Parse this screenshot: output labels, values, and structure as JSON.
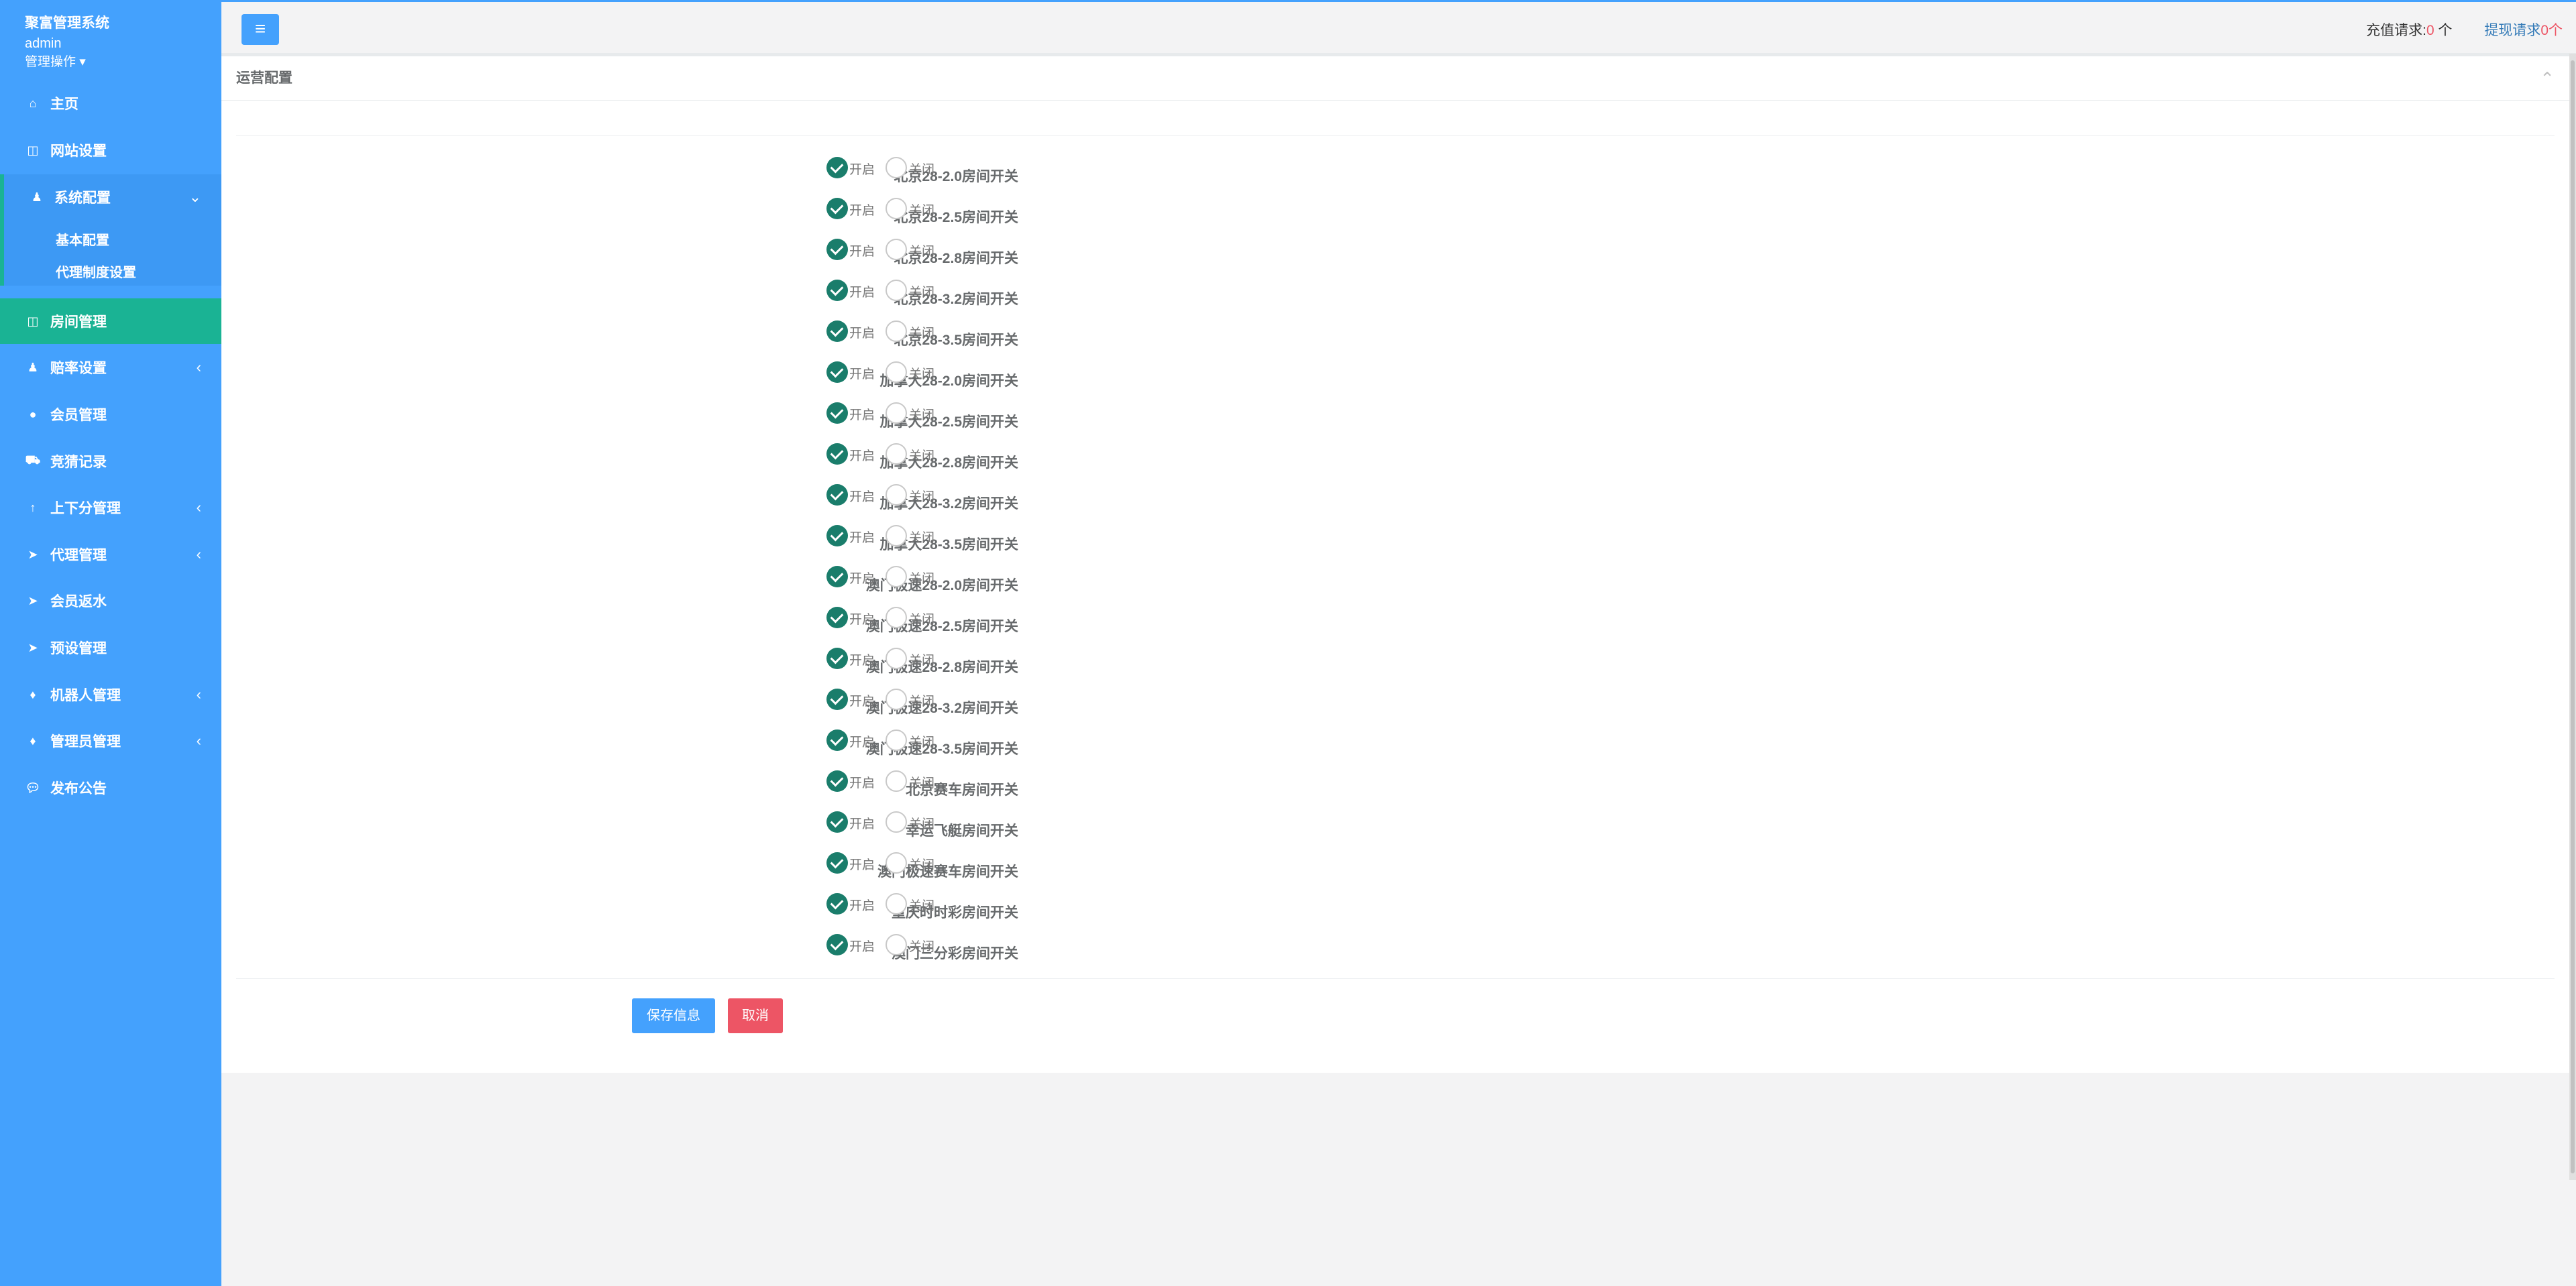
{
  "sidebar": {
    "system_name": "聚富管理系统",
    "username": "admin",
    "ops_label": "管理操作",
    "items": [
      {
        "label": "主页",
        "icon": "home-icon"
      },
      {
        "label": "网站设置",
        "icon": "columns-icon"
      },
      {
        "label": "系统配置",
        "icon": "user-icon",
        "expanded": true
      },
      {
        "label": "房间管理",
        "icon": "columns-icon",
        "active": true
      },
      {
        "label": "赔率设置",
        "icon": "user-icon"
      },
      {
        "label": "会员管理",
        "icon": "user-icon"
      },
      {
        "label": "竞猜记录",
        "icon": "car-icon"
      },
      {
        "label": "上下分管理",
        "icon": "arrow-up-icon"
      },
      {
        "label": "代理管理",
        "icon": "paper-plane-icon"
      },
      {
        "label": "会员返水",
        "icon": "paper-plane-icon"
      },
      {
        "label": "预设管理",
        "icon": "paper-plane-icon"
      },
      {
        "label": "机器人管理",
        "icon": "rocket-icon"
      },
      {
        "label": "管理员管理",
        "icon": "rocket-icon"
      },
      {
        "label": "发布公告",
        "icon": "comment-icon"
      }
    ],
    "submenu": [
      "基本配置",
      "代理制度设置"
    ]
  },
  "topbar": {
    "recharge_label": "充值请求:",
    "recharge_count": "0",
    "recharge_unit": " 个",
    "withdraw_label": "提现请求",
    "withdraw_count": "0",
    "withdraw_unit": "个"
  },
  "panel": {
    "title": "运营配置",
    "on_label": "开启",
    "off_label": "关闭",
    "save_label": "保存信息",
    "cancel_label": "取消",
    "settings": [
      {
        "label": "北京28-2.0房间开关",
        "value": "开启"
      },
      {
        "label": "北京28-2.5房间开关",
        "value": "开启"
      },
      {
        "label": "北京28-2.8房间开关",
        "value": "开启"
      },
      {
        "label": "北京28-3.2房间开关",
        "value": "开启"
      },
      {
        "label": "北京28-3.5房间开关",
        "value": "开启"
      },
      {
        "label": "加拿大28-2.0房间开关",
        "value": "开启"
      },
      {
        "label": "加拿大28-2.5房间开关",
        "value": "开启"
      },
      {
        "label": "加拿大28-2.8房间开关",
        "value": "开启"
      },
      {
        "label": "加拿大28-3.2房间开关",
        "value": "开启"
      },
      {
        "label": "加拿大28-3.5房间开关",
        "value": "开启"
      },
      {
        "label": "澳门极速28-2.0房间开关",
        "value": "开启"
      },
      {
        "label": "澳门极速28-2.5房间开关",
        "value": "开启"
      },
      {
        "label": "澳门极速28-2.8房间开关",
        "value": "开启"
      },
      {
        "label": "澳门极速28-3.2房间开关",
        "value": "开启"
      },
      {
        "label": "澳门极速28-3.5房间开关",
        "value": "开启"
      },
      {
        "label": "北京赛车房间开关",
        "value": "开启"
      },
      {
        "label": "幸运飞艇房间开关",
        "value": "开启"
      },
      {
        "label": "澳门极速赛车房间开关",
        "value": "开启"
      },
      {
        "label": "重庆时时彩房间开关",
        "value": "开启"
      },
      {
        "label": "澳门三分彩房间开关",
        "value": "开启"
      }
    ]
  },
  "colors": {
    "sidebar": "#44a1fd",
    "active": "#1ab394",
    "radio_on": "#1a7d6b",
    "danger": "#ed5565"
  }
}
